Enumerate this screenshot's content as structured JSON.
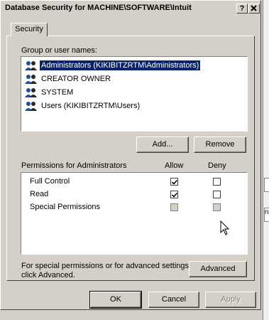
{
  "window": {
    "title": "Database Security for MACHINE\\SOFTWARE\\Intuit",
    "help_button": "?",
    "close_button": "X"
  },
  "tabs": [
    {
      "label": "Security"
    }
  ],
  "group_section": {
    "label": "Group or user names:",
    "items": [
      {
        "label": "Administrators (KIKIBITZRTM\\Administrators)",
        "selected": true,
        "icon": "users-group-icon"
      },
      {
        "label": "CREATOR OWNER",
        "selected": false,
        "icon": "users-group-icon"
      },
      {
        "label": "SYSTEM",
        "selected": false,
        "icon": "users-group-icon"
      },
      {
        "label": "Users (KIKIBITZRTM\\Users)",
        "selected": false,
        "icon": "users-group-icon"
      }
    ],
    "add_button": "Add...",
    "remove_button": "Remove"
  },
  "permissions": {
    "label": "Permissions for Administrators",
    "allow_header": "Allow",
    "deny_header": "Deny",
    "rows": [
      {
        "name": "Full Control",
        "allow": "checked",
        "deny": "unchecked"
      },
      {
        "name": "Read",
        "allow": "checked",
        "deny": "unchecked"
      },
      {
        "name": "Special Permissions",
        "allow": "greyed",
        "deny": "greyed"
      }
    ]
  },
  "advanced": {
    "text_line1": "For special permissions or for advanced settings,",
    "text_line2": "click Advanced.",
    "button": "Advanced"
  },
  "footer": {
    "ok": "OK",
    "cancel": "Cancel",
    "apply": "Apply"
  },
  "background": {
    "fragment": "n"
  }
}
